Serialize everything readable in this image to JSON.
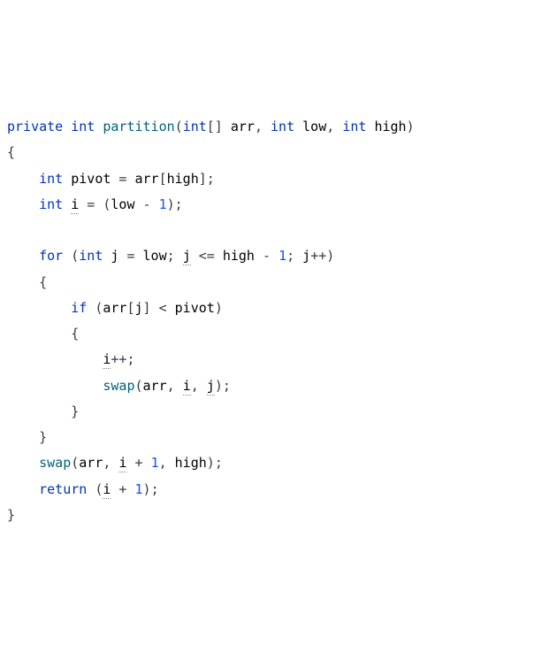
{
  "tokens": {
    "kw_private": "private",
    "kw_int": "int",
    "kw_for": "for",
    "kw_if": "if",
    "kw_return": "return",
    "fn_partition": "partition",
    "fn_swap": "swap",
    "id_arr": "arr",
    "id_low": "low",
    "id_high": "high",
    "id_pivot": "pivot",
    "id_i": "i",
    "id_j": "j",
    "num_1": "1",
    "sym_lbracket": "[",
    "sym_rbracket": "]",
    "sym_lbracket2": "[]",
    "sym_lparen": "(",
    "sym_rparen": ")",
    "sym_lbrace": "{",
    "sym_rbrace": "}",
    "sym_comma_sp": ", ",
    "sym_semicolon": ";",
    "sym_semicolon_sp": "; ",
    "sym_sp": " ",
    "sym_eq": " = ",
    "sym_minus": " - ",
    "sym_plus": " + ",
    "sym_le": " <= ",
    "sym_lt": " < ",
    "sym_incr": "++",
    "indent1": "    ",
    "indent2": "        ",
    "indent3": "            "
  }
}
